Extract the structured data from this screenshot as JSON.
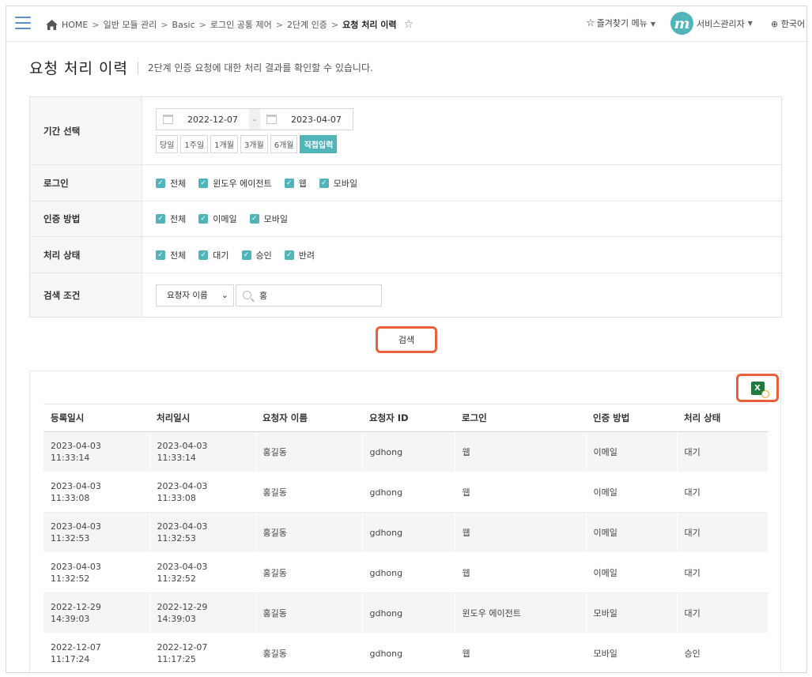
{
  "header": {
    "breadcrumb": [
      "HOME",
      "일반 모듈 관리",
      "Basic",
      "로그인 공통 제어",
      "2단계 인증"
    ],
    "current": "요청 처리 이력",
    "favorites": "즐겨찾기 메뉴",
    "user": "서비스관리자",
    "avatar_letter": "m",
    "language": "한국어"
  },
  "page": {
    "title": "요청 처리 이력",
    "description": "2단계 인증 요청에 대한 처리 결과를 확인할 수 있습니다."
  },
  "filters": {
    "period": {
      "label": "기간 선택",
      "start": "2022-12-07",
      "separator": "-",
      "end": "2023-04-07",
      "presets": [
        "당일",
        "1주일",
        "1개월",
        "3개월",
        "6개월",
        "직접입력"
      ],
      "active_preset": "직접입력"
    },
    "login": {
      "label": "로그인",
      "options": [
        "전체",
        "윈도우 에이전트",
        "웹",
        "모바일"
      ]
    },
    "auth_method": {
      "label": "인증 방법",
      "options": [
        "전체",
        "이메일",
        "모바일"
      ]
    },
    "status": {
      "label": "처리 상태",
      "options": [
        "전체",
        "대기",
        "승인",
        "반려"
      ]
    },
    "search": {
      "label": "검색 조건",
      "field": "요청자 이름",
      "query": "홍"
    }
  },
  "search_button": "검색",
  "table": {
    "headers": [
      "등록일시",
      "처리일시",
      "요청자 이름",
      "요청자 ID",
      "로그인",
      "인증 방법",
      "처리 상태"
    ],
    "rows": [
      {
        "reg_date": "2023-04-03",
        "reg_time": "11:33:14",
        "proc_date": "2023-04-03",
        "proc_time": "11:33:14",
        "name": "홍길동",
        "id": "gdhong",
        "login": "웹",
        "method": "이메일",
        "status": "대기"
      },
      {
        "reg_date": "2023-04-03",
        "reg_time": "11:33:08",
        "proc_date": "2023-04-03",
        "proc_time": "11:33:08",
        "name": "홍길동",
        "id": "gdhong",
        "login": "웹",
        "method": "이메일",
        "status": "대기"
      },
      {
        "reg_date": "2023-04-03",
        "reg_time": "11:32:53",
        "proc_date": "2023-04-03",
        "proc_time": "11:32:53",
        "name": "홍길동",
        "id": "gdhong",
        "login": "웹",
        "method": "이메일",
        "status": "대기"
      },
      {
        "reg_date": "2023-04-03",
        "reg_time": "11:32:52",
        "proc_date": "2023-04-03",
        "proc_time": "11:32:52",
        "name": "홍길동",
        "id": "gdhong",
        "login": "웹",
        "method": "이메일",
        "status": "대기"
      },
      {
        "reg_date": "2022-12-29",
        "reg_time": "14:39:03",
        "proc_date": "2022-12-29",
        "proc_time": "14:39:03",
        "name": "홍길동",
        "id": "gdhong",
        "login": "윈도우 에이전트",
        "method": "모바일",
        "status": "대기"
      },
      {
        "reg_date": "2022-12-07",
        "reg_time": "11:17:24",
        "proc_date": "2022-12-07",
        "proc_time": "11:17:25",
        "name": "홍길동",
        "id": "gdhong",
        "login": "웹",
        "method": "모바일",
        "status": "승인"
      }
    ]
  },
  "excel_icon_letter": "X",
  "colors": {
    "accent": "#4fb5ba",
    "highlight": "#e8613a",
    "menu_icon": "#5b8fc9",
    "excel": "#1f7a3f"
  },
  "icons": {
    "menu": "hamburger-menu-icon",
    "home": "home-icon",
    "favorite": "star-icon",
    "calendar": "calendar-icon",
    "search": "search-icon",
    "excel": "excel-download-icon",
    "language": "globe-icon"
  }
}
